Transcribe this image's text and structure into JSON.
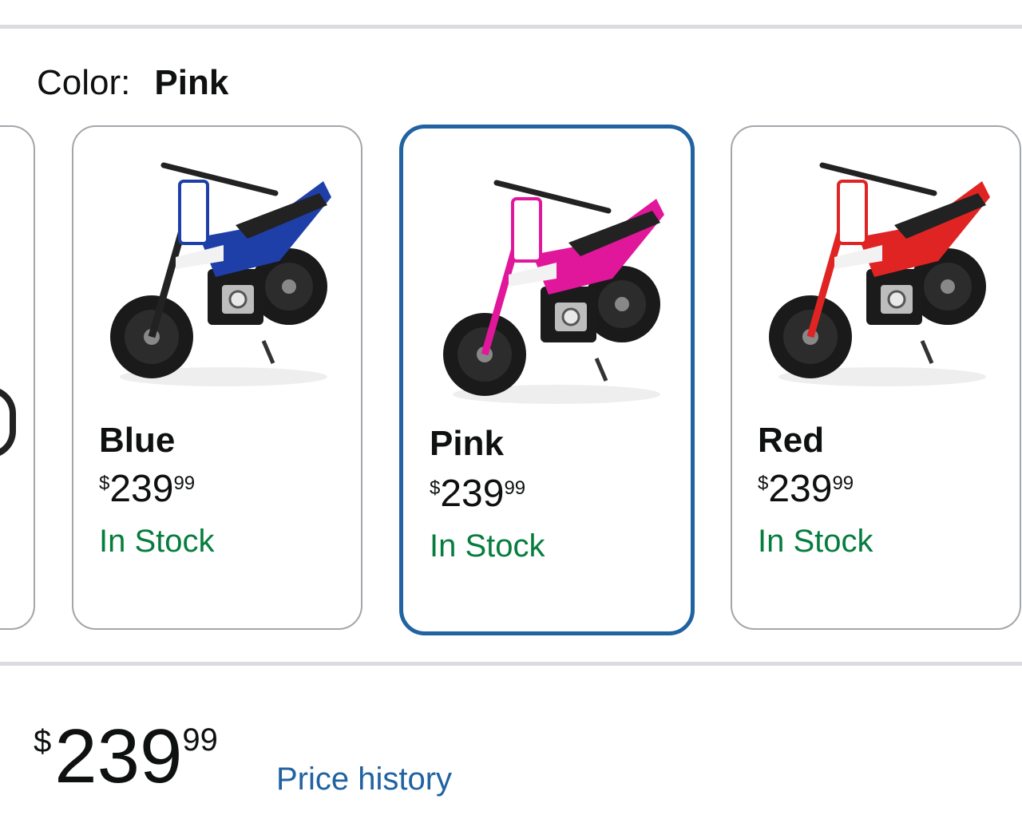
{
  "color_selector": {
    "label": "Color:",
    "selected": "Pink"
  },
  "swatches": [
    {
      "name": "Blue",
      "price_symbol": "$",
      "price_whole": "239",
      "price_fraction": "99",
      "stock": "In Stock",
      "accent": "#1f3fa8",
      "selected": false
    },
    {
      "name": "Pink",
      "price_symbol": "$",
      "price_whole": "239",
      "price_fraction": "99",
      "stock": "In Stock",
      "accent": "#e0179a",
      "selected": true
    },
    {
      "name": "Red",
      "price_symbol": "$",
      "price_whole": "239",
      "price_fraction": "99",
      "stock": "In Stock",
      "accent": "#e02424",
      "selected": false
    }
  ],
  "price": {
    "symbol": "$",
    "whole": "239",
    "fraction": "99",
    "history_link": "Price history"
  },
  "colors": {
    "in_stock": "#067d3e",
    "selected_border": "#2162a1",
    "link": "#2162a1"
  }
}
